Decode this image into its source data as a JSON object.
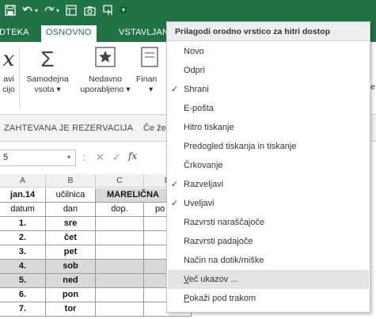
{
  "qat": {
    "save_icon": "save-icon",
    "undo_icon": "undo-icon",
    "redo_icon": "redo-icon",
    "customize_icon": "customize-qat-icon"
  },
  "tabs": [
    {
      "label": "DTEKA"
    },
    {
      "label": "OSNOVNO"
    },
    {
      "label": "VSTAVLJAN"
    }
  ],
  "ribbon": {
    "fx_label_1": "avi",
    "fx_label_2": "cijo",
    "autosum_label_1": "Samodejna",
    "autosum_label_2": "vsota ▾",
    "recent_label_1": "Nedavno",
    "recent_label_2": "uporabljeno ▾",
    "fin_label": "Finan",
    "fin_caret": "▾",
    "right_label": "e"
  },
  "message_bar": {
    "title": "ZAHTEVANA JE REZERVACIJA",
    "text": "Če že"
  },
  "formula_bar": {
    "name_box": "5",
    "name_box_caret": "▾",
    "colon": ":",
    "cancel": "✕",
    "enter": "✓",
    "fx": "fx"
  },
  "grid": {
    "columns": [
      "A",
      "B",
      "C",
      "D"
    ],
    "header_row_1": [
      "jan.14",
      "učilnica",
      "MARELIČNA"
    ],
    "header_row_2": [
      "datum",
      "dan",
      "dop.",
      "po"
    ],
    "rows": [
      [
        "1.",
        "sre"
      ],
      [
        "2.",
        "čet"
      ],
      [
        "3.",
        "pet"
      ],
      [
        "4.",
        "sob"
      ],
      [
        "5.",
        "ned"
      ],
      [
        "6.",
        "pon"
      ],
      [
        "7.",
        "tor"
      ]
    ]
  },
  "menu": {
    "title": "Prilagodi orodno vrstico za hitri dostop",
    "check_glyph": "✓",
    "items": [
      {
        "label": "Novo",
        "checked": false
      },
      {
        "label": "Odpri",
        "checked": false
      },
      {
        "label": "Shrani",
        "checked": true
      },
      {
        "label": "E-pošta",
        "checked": false
      },
      {
        "label": "Hitro tiskanje",
        "checked": false
      },
      {
        "label": "Predogled tiskanja in tiskanje",
        "checked": false
      },
      {
        "label": "Črkovanje",
        "checked": false
      },
      {
        "label": "Razveljavi",
        "checked": true
      },
      {
        "label": "Uveljavi",
        "checked": true
      },
      {
        "label": "Razvrsti naraščajoče",
        "checked": false
      },
      {
        "label": "Razvrsti padajoče",
        "checked": false
      },
      {
        "label": "Način na dotik/miške",
        "checked": false
      },
      {
        "label": "Več ukazov ...",
        "checked": false,
        "underline": "V",
        "rest": "eč ukazov ..."
      },
      {
        "label": "Pokaži pod trakom",
        "checked": false,
        "underline": "P",
        "rest": "okaži pod trakom"
      }
    ]
  },
  "colors": {
    "excel_green": "#217346",
    "highlight": "#e3e3e3",
    "shade": "#d9d9d9"
  }
}
